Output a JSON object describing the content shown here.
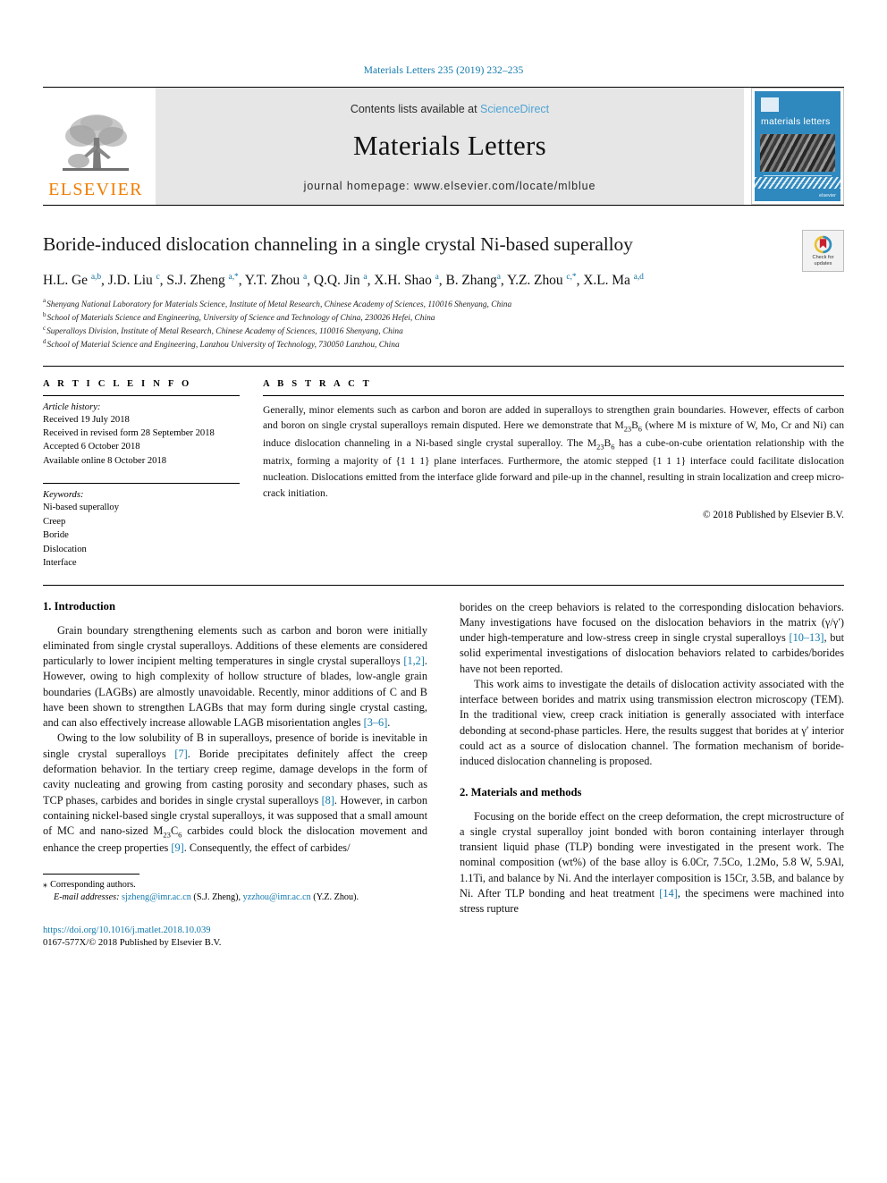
{
  "running_head": "Materials Letters 235 (2019) 232–235",
  "masthead": {
    "publisher_wordmark": "ELSEVIER",
    "contents_prefix": "Contents lists available at",
    "contents_link": "ScienceDirect",
    "journal_title": "Materials Letters",
    "homepage": "journal homepage: www.elsevier.com/locate/mlblue",
    "cover": {
      "journal_name": "materials letters",
      "footer": "elsevier"
    },
    "accent_link_color": "#4ea3d4",
    "elsevier_orange": "#ef7d00",
    "band_gray": "#e6e6e6"
  },
  "article": {
    "title": "Boride-induced dislocation channeling in a single crystal Ni-based superalloy",
    "crossmark": {
      "line1": "Check for",
      "line2": "updates"
    },
    "authors_html": "H.L. Ge <sup>a,b</sup>, J.D. Liu <sup>c</sup>, S.J. Zheng <sup>a,*</sup>, Y.T. Zhou <sup>a</sup>, Q.Q. Jin <sup>a</sup>, X.H. Shao <sup>a</sup>, B. Zhang<sup>a</sup>, Y.Z. Zhou <sup>c,*</sup>, X.L. Ma <sup>a,d</sup>",
    "affiliations": [
      {
        "mark": "a",
        "text": "Shenyang National Laboratory for Materials Science, Institute of Metal Research, Chinese Academy of Sciences, 110016 Shenyang, China"
      },
      {
        "mark": "b",
        "text": "School of Materials Science and Engineering, University of Science and Technology of China, 230026 Hefei, China"
      },
      {
        "mark": "c",
        "text": "Superalloys Division, Institute of Metal Research, Chinese Academy of Sciences, 110016 Shenyang, China"
      },
      {
        "mark": "d",
        "text": "School of Material Science and Engineering, Lanzhou University of Technology, 730050 Lanzhou, China"
      }
    ]
  },
  "article_info": {
    "heading": "A R T I C L E  I N F O",
    "history_label": "Article history:",
    "history": [
      "Received 19 July 2018",
      "Received in revised form 28 September 2018",
      "Accepted 6 October 2018",
      "Available online 8 October 2018"
    ],
    "keywords_label": "Keywords:",
    "keywords": [
      "Ni-based superalloy",
      "Creep",
      "Boride",
      "Dislocation",
      "Interface"
    ]
  },
  "abstract": {
    "heading": "A B S T R A C T",
    "text_html": "Generally, minor elements such as carbon and boron are added in superalloys to strengthen grain boundaries. However, effects of carbon and boron on single crystal superalloys remain disputed. Here we demonstrate that M<sub>23</sub>B<sub>6</sub> (where M is mixture of W, Mo, Cr and Ni) can induce dislocation channeling in a Ni-based single crystal superalloy. The M<sub>23</sub>B<sub>6</sub> has a cube-on-cube orientation relationship with the matrix, forming a majority of {1 1 1} plane interfaces. Furthermore, the atomic stepped {1 1 1} interface could facilitate dislocation nucleation. Dislocations emitted from the interface glide forward and pile-up in the channel, resulting in strain localization and creep micro-crack initiation.",
    "copyright": "© 2018 Published by Elsevier B.V."
  },
  "body": {
    "section1_heading": "1. Introduction",
    "section1_p1_html": "Grain boundary strengthening elements such as carbon and boron were initially eliminated from single crystal superalloys. Additions of these elements are considered particularly to lower incipient melting temperatures in single crystal superalloys <span class=\"ref\">[1,2]</span>. However, owing to high complexity of hollow structure of blades, low-angle grain boundaries (LAGBs) are almostly unavoidable. Recently, minor additions of C and B have been shown to strengthen LAGBs that may form during single crystal casting, and can also effectively increase allowable LAGB misorientation angles <span class=\"ref\">[3–6]</span>.",
    "section1_p2_html": "Owing to the low solubility of B in superalloys, presence of boride is inevitable in single crystal superalloys <span class=\"ref\">[7]</span>. Boride precipitates definitely affect the creep deformation behavior. In the tertiary creep regime, damage develops in the form of cavity nucleating and growing from casting porosity and secondary phases, such as TCP phases, carbides and borides in single crystal superalloys <span class=\"ref\">[8]</span>. However, in carbon containing nickel-based single crystal superalloys, it was supposed that a small amount of MC and nano-sized M<sub>23</sub>C<sub>6</sub> carbides could block the dislocation movement and enhance the creep properties <span class=\"ref\">[9]</span>. Consequently, the effect of carbides/",
    "section1_p3_html": "borides on the creep behaviors is related to the corresponding dislocation behaviors. Many investigations have focused on the dislocation behaviors in the matrix (γ/γ′) under high-temperature and low-stress creep in single crystal superalloys <span class=\"ref\">[10–13]</span>, but solid experimental investigations of dislocation behaviors related to carbides/borides have not been reported.",
    "section1_p4_html": "This work aims to investigate the details of dislocation activity associated with the interface between borides and matrix using transmission electron microscopy (TEM). In the traditional view, creep crack initiation is generally associated with interface debonding at second-phase particles. Here, the results suggest that borides at γ′ interior could act as a source of dislocation channel. The formation mechanism of boride-induced dislocation channeling is proposed.",
    "section2_heading": "2. Materials and methods",
    "section2_p1_html": "Focusing on the boride effect on the creep deformation, the crept microstructure of a single crystal superalloy joint bonded with boron containing interlayer through transient liquid phase (TLP) bonding were investigated in the present work. The nominal composition (wt%) of the base alloy is 6.0Cr, 7.5Co, 1.2Mo, 5.8 W, 5.9Al, 1.1Ti, and balance by Ni. And the interlayer composition is 15Cr, 3.5B, and balance by Ni. After TLP bonding and heat treatment <span class=\"ref\">[14]</span>, the specimens were machined into stress rupture"
  },
  "footnote": {
    "star": "⁎",
    "corresponding": "Corresponding authors.",
    "email_label": "E-mail addresses:",
    "email1": "sjzheng@imr.ac.cn",
    "email1_owner": "(S.J. Zheng),",
    "email2": "yzzhou@imr.ac.cn",
    "email2_owner": "(Y.Z. Zhou)."
  },
  "doi": {
    "url": "https://doi.org/10.1016/j.matlet.2018.10.039",
    "issn_line": "0167-577X/© 2018 Published by Elsevier B.V."
  }
}
